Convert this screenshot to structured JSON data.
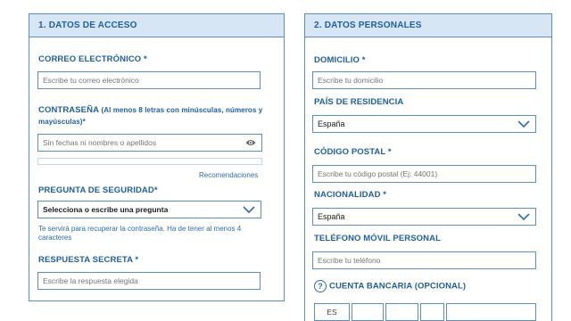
{
  "section1": {
    "title": "1. DATOS DE ACCESO",
    "email": {
      "label": "CORREO ELECTRÓNICO *",
      "placeholder": "Escribe tu correo electrónico"
    },
    "password": {
      "label": "CONTRASEÑA",
      "label_hint": "(Al menos 8 letras con minúsculas, números y",
      "label_hint2": "mayúsculas)*",
      "placeholder": "Sin fechas ni nombres o apellidos",
      "eye_icon": "eye-icon",
      "recommendations": "Recomendaciones"
    },
    "security_question": {
      "label": "PREGUNTA DE SEGURIDAD*",
      "value": "Selecciona o escribe una pregunta",
      "hint_line1": "Te servirá para recuperar la contraseña. Ha de tener al menos 4",
      "hint_line2": "caracteres"
    },
    "secret_answer": {
      "label": "RESPUESTA SECRETA *",
      "placeholder": "Escribe la respuesta elegida"
    }
  },
  "section2": {
    "title": "2. DATOS PERSONALES",
    "address": {
      "label": "DOMICILIO *",
      "placeholder": "Escribe tu domicilio"
    },
    "country": {
      "label": "PAÍS DE RESIDENCIA",
      "value": "España"
    },
    "postal_code": {
      "label": "CÓDIGO POSTAL *",
      "placeholder": "Escribe tu código postal (Ej: 44001)"
    },
    "nationality": {
      "label": "NACIONALIDAD *",
      "value": "España"
    },
    "phone": {
      "label": "TELÉFONO MÓVIL PERSONAL",
      "placeholder": "Escribe tu teléfono"
    },
    "bank": {
      "label": "CUENTA BANCARIA (OPCIONAL)",
      "help_icon": "?",
      "prefix": "ES"
    }
  },
  "colors": {
    "accent": "#1f5fa0",
    "border": "#5a8fc4",
    "header_bg": "#d7e6f4"
  }
}
